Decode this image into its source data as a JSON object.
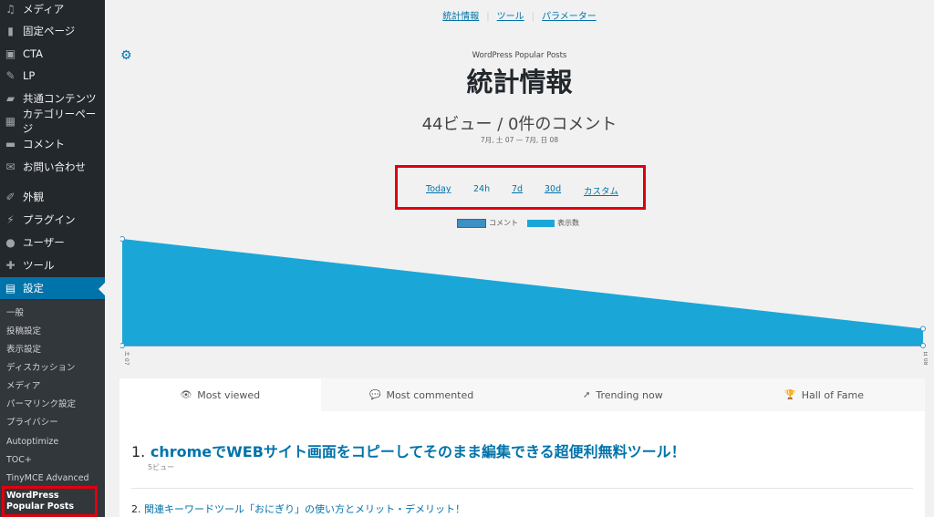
{
  "sidebar": {
    "items": [
      {
        "label": "メディア",
        "icon": "media-icon"
      },
      {
        "label": "固定ページ",
        "icon": "page-icon"
      },
      {
        "label": "CTA",
        "icon": "cta-icon"
      },
      {
        "label": "LP",
        "icon": "lp-icon"
      },
      {
        "label": "共通コンテンツ",
        "icon": "folder-icon"
      },
      {
        "label": "カテゴリーページ",
        "icon": "category-icon"
      },
      {
        "label": "コメント",
        "icon": "comment-icon"
      },
      {
        "label": "お問い合わせ",
        "icon": "mail-icon"
      },
      {
        "label": "外観",
        "icon": "brush-icon"
      },
      {
        "label": "プラグイン",
        "icon": "plugin-icon"
      },
      {
        "label": "ユーザー",
        "icon": "user-icon"
      },
      {
        "label": "ツール",
        "icon": "wrench-icon"
      },
      {
        "label": "設定",
        "icon": "settings-icon"
      }
    ],
    "submenu": [
      "一般",
      "投稿設定",
      "表示設定",
      "ディスカッション",
      "メディア",
      "パーマリンク設定",
      "プライバシー",
      "Autoptimize",
      "TOC+",
      "TinyMCE Advanced",
      "WordPress Popular Posts"
    ]
  },
  "main": {
    "toplinks": [
      "統計情報",
      "ツール",
      "パラメーター"
    ],
    "plugin_name": "WordPress Popular Posts",
    "title": "統計情報",
    "summary": "44ビュー / 0件のコメント",
    "daterange": "7月, 土 07 — 7月, 日 08",
    "ranges": [
      "Today",
      "24h",
      "7d",
      "30d",
      "カスタム"
    ],
    "legend": [
      "コメント",
      "表示数"
    ],
    "tabs": [
      {
        "label": "Most viewed",
        "icon": "eye-icon"
      },
      {
        "label": "Most commented",
        "icon": "comment-icon"
      },
      {
        "label": "Trending now",
        "icon": "rocket-icon"
      },
      {
        "label": "Hall of Fame",
        "icon": "trophy-icon"
      }
    ],
    "list": [
      {
        "num": "1.",
        "title": "chromeでWEBサイト画面をコピーしてそのまま編集できる超便利無料ツール！",
        "views": "5ビュー"
      },
      {
        "num": "2.",
        "title": "関連キーワードツール「おにぎり」の使い方とメリット・デメリット！"
      }
    ]
  },
  "colors": {
    "accent": "#0073aa",
    "sidebar_bg": "#23282d",
    "highlight": "#e0000e",
    "area_fill": "#1ba6d8",
    "comment_color": "#3d8fc4"
  },
  "chart_data": {
    "type": "area",
    "x": [
      "土 07",
      "日 08"
    ],
    "series": [
      {
        "name": "表示数",
        "values": [
          38,
          6
        ]
      },
      {
        "name": "コメント",
        "values": [
          0,
          0
        ]
      }
    ]
  }
}
